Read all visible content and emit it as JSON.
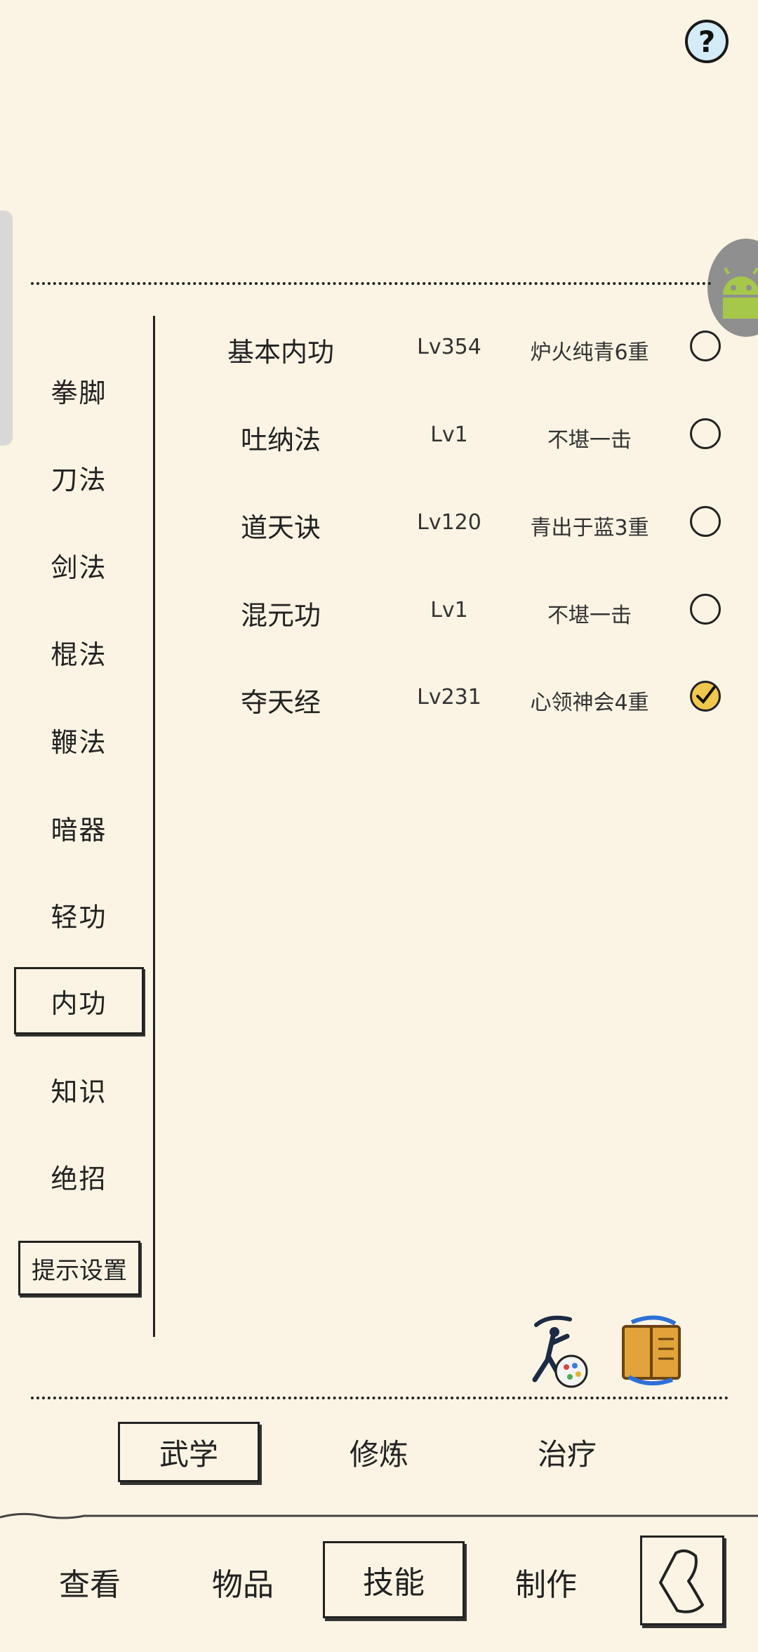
{
  "help": {
    "symbol": "?"
  },
  "categories": [
    {
      "label": "拳脚"
    },
    {
      "label": "刀法"
    },
    {
      "label": "剑法"
    },
    {
      "label": "棍法"
    },
    {
      "label": "鞭法"
    },
    {
      "label": "暗器"
    },
    {
      "label": "轻功"
    },
    {
      "label": "内功"
    },
    {
      "label": "知识"
    },
    {
      "label": "绝招"
    }
  ],
  "selected_category": "内功",
  "hint_settings_label": "提示设置",
  "skills": [
    {
      "name": "基本内功",
      "level": "Lv354",
      "tier": "炉火纯青6重",
      "checked": false
    },
    {
      "name": "吐纳法",
      "level": "Lv1",
      "tier": "不堪一击",
      "checked": false
    },
    {
      "name": "道天诀",
      "level": "Lv120",
      "tier": "青出于蓝3重",
      "checked": false
    },
    {
      "name": "混元功",
      "level": "Lv1",
      "tier": "不堪一击",
      "checked": false
    },
    {
      "name": "夺天经",
      "level": "Lv231",
      "tier": "心领神会4重",
      "checked": true
    }
  ],
  "action_icons": [
    "martial-art-style-icon",
    "skill-swap-book-icon"
  ],
  "sub_tabs": [
    {
      "label": "武学",
      "selected": true
    },
    {
      "label": "修炼",
      "selected": false
    },
    {
      "label": "治疗",
      "selected": false
    }
  ],
  "bottom_nav": [
    {
      "label": "查看",
      "selected": false
    },
    {
      "label": "物品",
      "selected": false
    },
    {
      "label": "技能",
      "selected": true
    },
    {
      "label": "制作",
      "selected": false
    }
  ],
  "colors": {
    "background": "#fbf4e4",
    "ink": "#222222",
    "check_fill": "#f1c74c",
    "help_fill": "#d4ecf8"
  }
}
